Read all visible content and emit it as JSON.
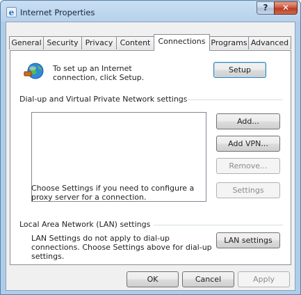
{
  "window": {
    "title": "Internet Properties",
    "help_glyph": "?",
    "close_glyph": "✕"
  },
  "tabs": [
    {
      "label": "General"
    },
    {
      "label": "Security"
    },
    {
      "label": "Privacy"
    },
    {
      "label": "Content"
    },
    {
      "label": "Connections",
      "active": true
    },
    {
      "label": "Programs"
    },
    {
      "label": "Advanced"
    }
  ],
  "setup": {
    "text": "To set up an Internet connection, click Setup.",
    "button": "Setup"
  },
  "dialup": {
    "heading": "Dial-up and Virtual Private Network settings",
    "add_button": "Add...",
    "add_vpn_button": "Add VPN...",
    "remove_button": "Remove...",
    "proxy_text": "Choose Settings if you need to configure a proxy server for a connection.",
    "settings_button": "Settings"
  },
  "lan": {
    "heading": "Local Area Network (LAN) settings",
    "text": "LAN Settings do not apply to dial-up connections. Choose Settings above for dial-up settings.",
    "button": "LAN settings"
  },
  "footer": {
    "ok": "OK",
    "cancel": "Cancel",
    "apply": "Apply"
  },
  "colors": {
    "title_bar": "#b6d1ec",
    "close_button": "#c8533b",
    "default_button_border": "#3c7fb1",
    "disabled_text": "#8b8b8b"
  }
}
